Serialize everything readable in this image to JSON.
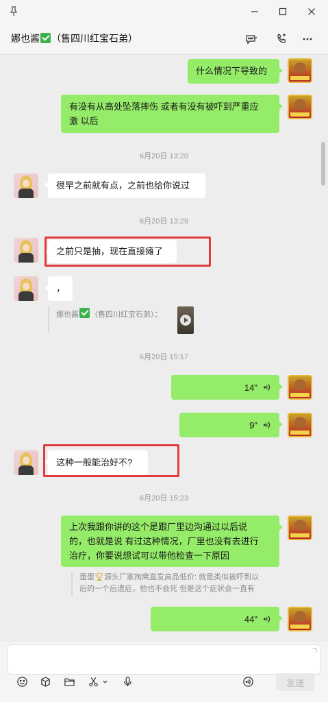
{
  "window": {
    "title": ""
  },
  "chat": {
    "contact_name_prefix": "娜也酱",
    "contact_name_suffix": "（售四川红宝石弟）"
  },
  "messages": {
    "m1": "什么情况下导致的",
    "m2_line1": "有没有从高处坠落摔伤 或者有没有被吓到严重应",
    "m2_line2": "激  以后",
    "t1": "6月20日 13:20",
    "m3": "很早之前就有点，之前也给你说过",
    "t2": "6月20日 13:29",
    "m4": "之前只是抽，现在直接瘫了",
    "m5": "，",
    "m5_quote_prefix": "娜也酱",
    "m5_quote_suffix": "（售四川红宝石弟）：",
    "t3": "6月20日 15:17",
    "v1": "14\"",
    "v2": "9\"",
    "m6": "这种一般能治好不?",
    "t4": "6月20日 15:23",
    "m7_line1": "上次我跟你讲的这个是跟厂里边沟通过以后说",
    "m7_line2": "的，也就是说 有过这种情况，厂里也没有去进行",
    "m7_line3": "治疗，你要说想试可以带他检查一下原因",
    "m7_quote_prefix": "蛋蛋",
    "m7_quote_line1": "源头厂家掏窝直发高品低价: 就是类似被吓到以",
    "m7_quote_line2": "后的一个后遗症，他也不会死 但是这个症状会一直有",
    "v3": "44\""
  },
  "composer": {
    "send_label": "发送"
  },
  "colors": {
    "outgoing_bubble": "#95ec69",
    "incoming_bubble": "#ffffff",
    "highlight_box": "#e13b3b",
    "verified_check": "#3cb14a"
  },
  "icons": {
    "titlebar": [
      "pin-icon",
      "minimize-icon",
      "maximize-icon",
      "close-icon"
    ],
    "header": [
      "chat-bubble-icon",
      "phone-icon",
      "more-icon"
    ],
    "toolbar": [
      "emoji-icon",
      "cube-icon",
      "folder-icon",
      "scissors-icon",
      "chevron-down-icon",
      "microphone-icon",
      "voice-input-icon"
    ]
  }
}
